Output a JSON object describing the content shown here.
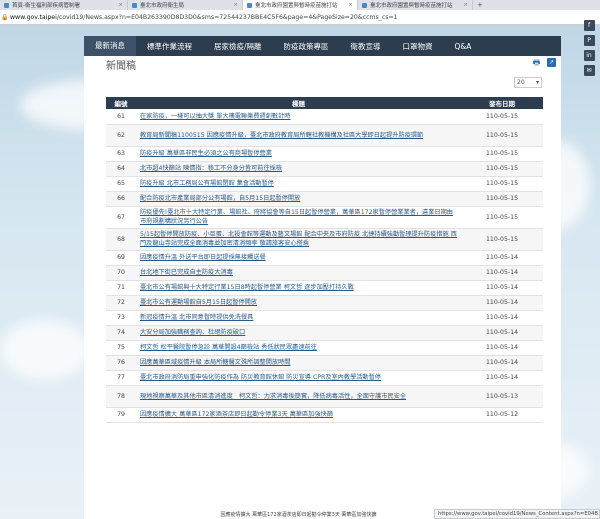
{
  "browser": {
    "tabs": [
      {
        "label": "首頁-衛生福利部疾病管制署"
      },
      {
        "label": "臺北市政府衛生局"
      },
      {
        "label": "臺北市政府園置與暫時疫苗施打站"
      },
      {
        "label": "臺北市政府園置與暫時疫苗施打站"
      }
    ],
    "new_tab": "+",
    "url_host": "www.gov.taipei",
    "url_path": "/covid19/News.aspx?n=E04B263390D8D3D0&sms=72544237BBE4C5F6&page=4&PageSize=20&ccms_cs=1"
  },
  "nav": {
    "items": [
      "最新消息",
      "標準作業流程",
      "居家檢疫/隔離",
      "防疫政策專區",
      "衛教宣導",
      "口罩物資",
      "Q&A"
    ],
    "search_label": "搜尋"
  },
  "social": [
    "f",
    "P",
    "in",
    "✉"
  ],
  "page": {
    "title": "新聞稿",
    "page_size": "20",
    "columns": {
      "no": "編號",
      "title": "標題",
      "date": "發布日期"
    },
    "rows": [
      {
        "no": "61",
        "title": "在家防疫，一樣可以抽大獎 單大樓電聯樂費週創數計時",
        "date": "110-05-15"
      },
      {
        "no": "62",
        "title": "教育局新聞稿1100515 因應疫情升級，臺北市政府教育局所轄社教機構及社區大學即日起提升防疫環節",
        "date": "110-05-15"
      },
      {
        "no": "63",
        "title": "防疫升級 萬華區非民生必須之公有商場暫停營業",
        "date": "110-05-15"
      },
      {
        "no": "64",
        "title": "北市超4快篩站 陳情指：移工不分身分皆可前往採檢",
        "date": "110-05-15"
      },
      {
        "no": "65",
        "title": "防疫升級 北市工務局公有場館閉館 集會活動暫停",
        "date": "110-05-15"
      },
      {
        "no": "66",
        "title": "配合防疫北市產業局部分公有場館，自5月15日起暫停開放",
        "date": "110-05-15"
      },
      {
        "no": "67",
        "title": "防疫優先!臺北市十大特定行業、場館社、府將協會等自15日起暫停營業，萬華區172家暫停營業業者，違業日期由市府規劃構狀況另行公告",
        "date": "110-05-15"
      },
      {
        "no": "68",
        "title": "5/15起暫停開放防疫、小巨蛋、北投會館等運動及藝文場館 配合中央及市府防疫 北捷持續強勸暫理提升防疫措施 西門及龍山寺站完成全面消毒並加密清消頻率 敬請旅客安心搭乘",
        "date": "110-05-15"
      },
      {
        "no": "69",
        "title": "因應疫情升溫 外送平台即日起提採無接觸送餐",
        "date": "110-05-14"
      },
      {
        "no": "70",
        "title": "台北地下街已完成自主防疫大消毒",
        "date": "110-05-14"
      },
      {
        "no": "71",
        "title": "臺北市公有場館與十大特定行業15日8時起暫停營業 柯文哲 逐步加壓打持久戰",
        "date": "110-05-14"
      },
      {
        "no": "72",
        "title": "臺北市公有運動場館自5月15日起暫停開放",
        "date": "110-05-14"
      },
      {
        "no": "73",
        "title": "新冠疫情升溫 北市同意暫時提供免洗餐具",
        "date": "110-05-14"
      },
      {
        "no": "74",
        "title": "大安分局加強職務查詢、杜絕防疫破口",
        "date": "110-05-14"
      },
      {
        "no": "75",
        "title": "柯文哲 松平醫院暫停急診 萬華開設4篩檢站 秀低狀民眾盡速前往",
        "date": "110-05-14"
      },
      {
        "no": "76",
        "title": "因應萬華區域疫情升級 本局所轄醫文殊所調整開放時間",
        "date": "110-05-14"
      },
      {
        "no": "77",
        "title": "臺北市政府消防局重申強化防疫作為 防災教育館休館 防災宣導 CPR及室內教學活動暫停",
        "date": "110-05-14"
      },
      {
        "no": "78",
        "title": "現地視察萬華及其他市區清消進度　柯文哲：力求消毒後簡實，降低病毒活性，全面守護市民安全",
        "date": "110-05-13"
      },
      {
        "no": "79",
        "title": "因應疫情擴大 萬華區172家酒茶店即日起勸令停業3天 萬華區加強快篩",
        "date": "110-05-12"
      }
    ]
  },
  "status_url": "https://www.gov.taipei/covid19/News_Content.aspx?n=E04B",
  "ticker": "因應疫情擴大 萬華區172家酒茶店即日起勸令停業3天 萬華區加強快篩"
}
